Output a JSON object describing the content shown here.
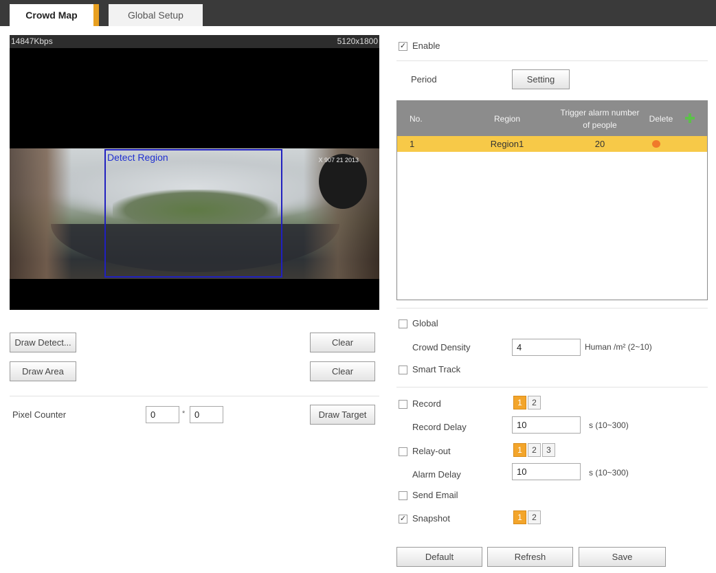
{
  "tabs": {
    "crowd_map": "Crowd Map",
    "global_setup": "Global Setup"
  },
  "video": {
    "bitrate": "14847Kbps",
    "resolution": "5120x1800",
    "detect_region_label": "Detect Region",
    "overlay_text": "X 907 21 2013"
  },
  "left_panel": {
    "draw_detect": "Draw Detect...",
    "clear_1": "Clear",
    "draw_area": "Draw Area",
    "clear_2": "Clear",
    "pixel_counter_label": "Pixel Counter",
    "pixel_w": "0",
    "pixel_sep": "*",
    "pixel_h": "0",
    "draw_target": "Draw Target"
  },
  "right_panel": {
    "enable_label": "Enable",
    "enable_checked": "✓",
    "period_label": "Period",
    "setting_button": "Setting",
    "table": {
      "headers": {
        "no": "No.",
        "region": "Region",
        "trigger": "Trigger alarm number of people",
        "delete": "Delete"
      },
      "rows": [
        {
          "no": "1",
          "region": "Region1",
          "trigger": "20"
        }
      ]
    },
    "global_label": "Global",
    "crowd_density_label": "Crowd Density",
    "crowd_density_value": "4",
    "crowd_density_unit": "Human /m² (2~10)",
    "smart_track_label": "Smart Track",
    "record_label": "Record",
    "record_channels": [
      "1",
      "2"
    ],
    "record_delay_label": "Record Delay",
    "record_delay_value": "10",
    "record_delay_unit": "s (10~300)",
    "relay_out_label": "Relay-out",
    "relay_channels": [
      "1",
      "2",
      "3"
    ],
    "alarm_delay_label": "Alarm Delay",
    "alarm_delay_value": "10",
    "alarm_delay_unit": "s (10~300)",
    "send_email_label": "Send Email",
    "snapshot_label": "Snapshot",
    "snapshot_checked": "✓",
    "snapshot_channels": [
      "1",
      "2"
    ],
    "default_button": "Default",
    "refresh_button": "Refresh",
    "save_button": "Save"
  },
  "colors": {
    "accent": "#f3a52b",
    "selected_row": "#f7c948",
    "header": "#8c8c8c",
    "region_border": "#2020c0"
  }
}
